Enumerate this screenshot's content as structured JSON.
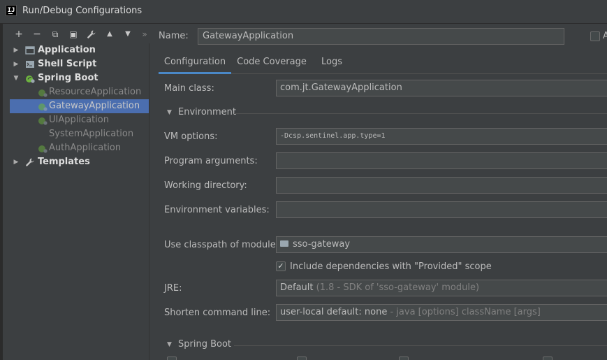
{
  "window": {
    "title": "Run/Debug Configurations",
    "app_icon_text": "IJ"
  },
  "toolbar": {
    "add": "+",
    "remove": "−",
    "copy": "⧉",
    "save": "▣",
    "edit": "🔧",
    "up": "▲",
    "down": "▼",
    "more": "»"
  },
  "tree": {
    "items": [
      {
        "label": "Application",
        "kind": "group",
        "expanded": false
      },
      {
        "label": "Shell Script",
        "kind": "group",
        "expanded": false
      },
      {
        "label": "Spring Boot",
        "kind": "group",
        "expanded": true
      },
      {
        "label": "ResourceApplication",
        "kind": "config",
        "muted": true
      },
      {
        "label": "GatewayApplication",
        "kind": "config",
        "selected": true
      },
      {
        "label": "UIApplication",
        "kind": "config",
        "muted": true
      },
      {
        "label": "SystemApplication",
        "kind": "config",
        "muted": true
      },
      {
        "label": "AuthApplication",
        "kind": "config",
        "muted": true
      },
      {
        "label": "Templates",
        "kind": "group",
        "expanded": false
      }
    ]
  },
  "form": {
    "name_label": "Name:",
    "name_value": "GatewayApplication",
    "share_label": "A",
    "tabs": [
      "Configuration",
      "Code Coverage",
      "Logs"
    ],
    "main_class_label": "Main class:",
    "main_class_value": "com.jt.GatewayApplication",
    "environment_section": "Environment",
    "vm_options_label": "VM options:",
    "vm_options_value": "-Dcsp.sentinel.app.type=1",
    "program_args_label": "Program arguments:",
    "program_args_value": "",
    "working_dir_label": "Working directory:",
    "working_dir_value": "",
    "env_vars_label": "Environment variables:",
    "env_vars_value": "",
    "classpath_label": "Use classpath of module:",
    "classpath_value": "sso-gateway",
    "include_deps_label": "Include dependencies with \"Provided\" scope",
    "include_deps_checked": true,
    "jre_label": "JRE:",
    "jre_value": "Default",
    "jre_hint": "(1.8 - SDK of 'sso-gateway' module)",
    "shorten_label": "Shorten command line:",
    "shorten_value": "user-local default: none",
    "shorten_hint": "- java [options] className [args]",
    "spring_boot_section": "Spring Boot"
  },
  "colors": {
    "background": "#3c3f41",
    "selection": "#4b6eaf",
    "tab_underline": "#4a88c7",
    "spring_icon": "#6db33f"
  }
}
